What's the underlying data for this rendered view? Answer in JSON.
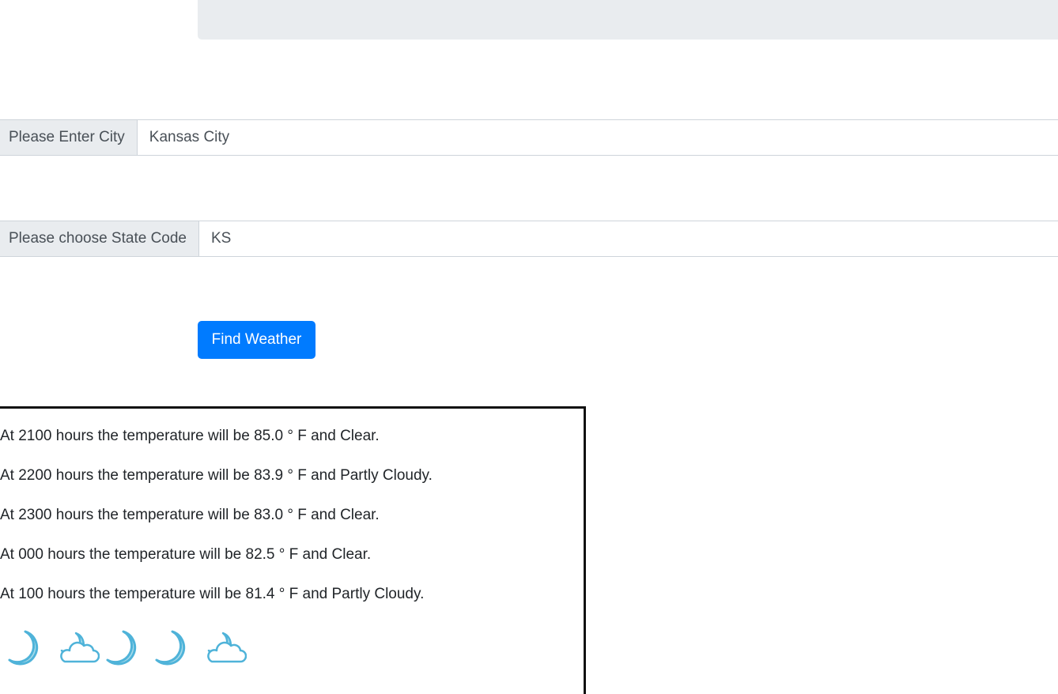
{
  "form": {
    "city_label": "Please Enter City",
    "city_value": "Kansas City",
    "state_label": "Please choose State Code",
    "state_value": "KS",
    "submit_label": "Find Weather"
  },
  "forecast": {
    "lines": [
      "At 2100 hours the temperature will be 85.0 ° F and Clear.",
      "At 2200 hours the temperature will be 83.9 ° F and Partly Cloudy.",
      "At 2300 hours the temperature will be 83.0 ° F and Clear.",
      "At 000 hours the temperature will be 82.5 ° F and Clear.",
      "At 100 hours the temperature will be 81.4 ° F and Partly Cloudy."
    ],
    "icons": [
      "moon-icon",
      "partly-cloudy-night-icon",
      "moon-icon",
      "moon-icon",
      "partly-cloudy-night-icon"
    ]
  },
  "colors": {
    "primary": "#007bff",
    "addon_bg": "#e9ecef",
    "icon_fill": "#a8dcea",
    "icon_stroke": "#4fb3d9"
  }
}
